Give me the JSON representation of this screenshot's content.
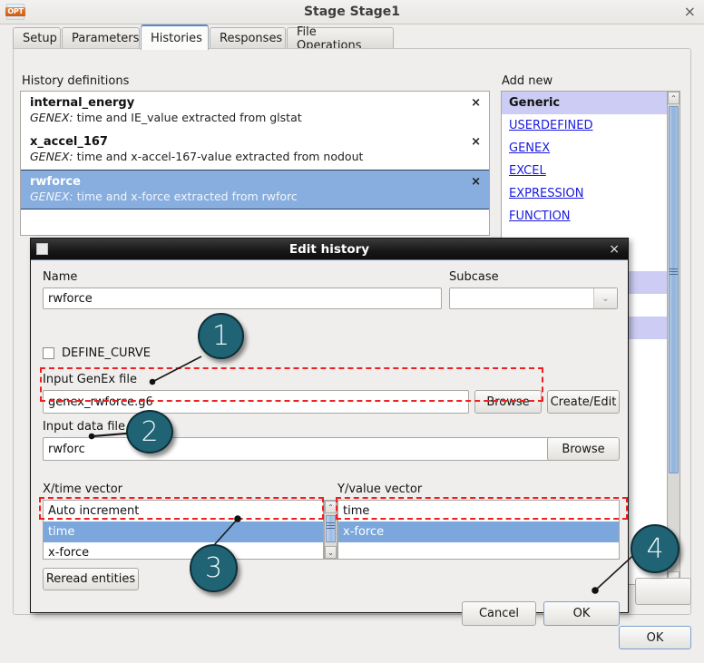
{
  "window": {
    "title": "Stage Stage1",
    "icon": "opt-icon",
    "close": "×"
  },
  "tabs": [
    {
      "label": "Setup",
      "active": false
    },
    {
      "label": "Parameters",
      "active": false
    },
    {
      "label": "Histories",
      "active": true
    },
    {
      "label": "Responses",
      "active": false
    },
    {
      "label": "File Operations",
      "active": false
    }
  ],
  "sections": {
    "history_definitions_label": "History definitions",
    "add_new_label": "Add new"
  },
  "history_definitions": [
    {
      "name": "internal_energy",
      "desc_prefix": "GENEX:",
      "desc": " time and IE_value extracted from glstat",
      "selected": false,
      "remove": "×"
    },
    {
      "name": "x_accel_167",
      "desc_prefix": "GENEX:",
      "desc": " time and x-accel-167-value extracted from nodout",
      "selected": false,
      "remove": "×"
    },
    {
      "name": "rwforce",
      "desc_prefix": "GENEX:",
      "desc": " time and x-force extracted from rwforc",
      "selected": true,
      "remove": "×"
    }
  ],
  "add_new": {
    "header": "Generic",
    "items": [
      "USERDEFINED",
      "GENEX",
      "EXCEL",
      "EXPRESSION",
      "FUNCTION"
    ],
    "scroll_up": "⌃",
    "scroll_down": "⌄"
  },
  "main_ok_label": "OK",
  "dialog": {
    "title": "Edit history",
    "close": "×",
    "name_label": "Name",
    "name_value": "rwforce",
    "subcase_label": "Subcase",
    "subcase_value": "",
    "subcase_arrow": "⌄",
    "define_curve_label": "DEFINE_CURVE",
    "define_curve_checked": false,
    "genex_label": "Input GenEx file",
    "genex_value": "genex_rwforce.g6",
    "genex_browse": "Browse",
    "genex_create_edit": "Create/Edit",
    "datafile_label": "Input data file",
    "datafile_value": "rwforc",
    "datafile_browse": "Browse",
    "xvector_label": "X/time vector",
    "xvector_items": [
      {
        "label": "Auto increment",
        "selected": false
      },
      {
        "label": "time",
        "selected": true
      },
      {
        "label": "x-force",
        "selected": false
      }
    ],
    "yvector_label": "Y/value vector",
    "yvector_items": [
      {
        "label": "time",
        "selected": false
      },
      {
        "label": "x-force",
        "selected": true
      }
    ],
    "reread_label": "Reread entities",
    "cancel_label": "Cancel",
    "ok_label": "OK",
    "scroll_up": "⌃",
    "scroll_down": "⌄"
  },
  "annotations": [
    {
      "number": "1"
    },
    {
      "number": "2"
    },
    {
      "number": "3"
    },
    {
      "number": "4"
    }
  ],
  "colors": {
    "highlight_red": "#ef2020",
    "callout_teal": "#1f6374",
    "selection_blue": "#87aede",
    "lilac": "#ccccf4",
    "link_blue": "#1a1ae0"
  }
}
